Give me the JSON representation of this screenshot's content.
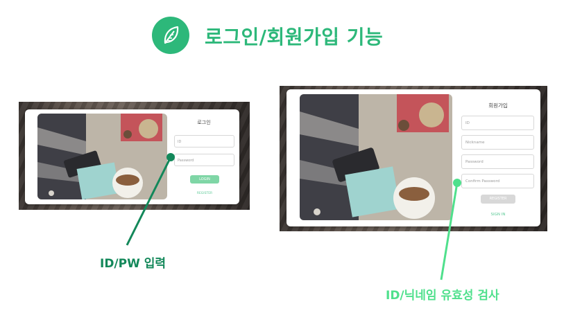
{
  "header": {
    "title": "로그인/회원가입 기능",
    "icon": "leaf-icon",
    "accent_color": "#2db87a"
  },
  "login_panel": {
    "form_title": "로그인",
    "id_placeholder": "ID",
    "password_placeholder": "Password",
    "login_button": "LOGIN",
    "register_link": "REGISTER"
  },
  "signup_panel": {
    "form_title": "회원가입",
    "id_placeholder": "ID",
    "nickname_placeholder": "Nickname",
    "password_placeholder": "Password",
    "confirm_placeholder": "Confirm Password",
    "register_button": "REGISTER",
    "signin_link": "SIGN IN"
  },
  "annotations": {
    "login_note": "ID/PW 입력",
    "login_note_color": "#13885a",
    "signup_note": "ID/닉네임 유효성 검사",
    "signup_note_color": "#4fe08c"
  }
}
